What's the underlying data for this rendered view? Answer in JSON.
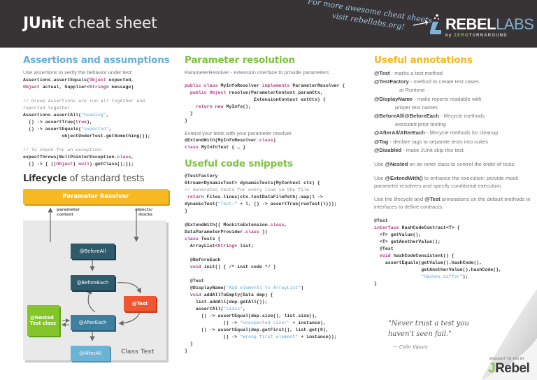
{
  "header": {
    "title_bold": "JUnit",
    "title_rest": " cheat sheet",
    "promo_line1": "For more awesome cheat sheets",
    "promo_line2": "visit rebellabs.org!",
    "logo_rebel": "REBEL",
    "logo_labs": "LABS",
    "logo_by": "by ",
    "logo_zero": "ZERO",
    "logo_turnaround": "TURNAROUND"
  },
  "assertions": {
    "heading": "Assertions and assumptions",
    "intro": "Use assertions to verify the behavior under test:",
    "signature_l1_a": "Assertions.assertEquals(",
    "signature_l1_kw": "Object",
    "signature_l1_b": " expected,",
    "signature_l2_kw": "Object",
    "signature_l2_a": " actual, Supplier<",
    "signature_l2_kw2": "String",
    "signature_l2_b": "> message)",
    "comment1_l1": "// Group assertions are run all together and",
    "comment1_l2": "reported together.",
    "group_l1_a": "Assertions.assertAll(",
    "group_l1_str": "\"heading\"",
    "group_l1_b": ",",
    "group_l2_a": "  () -> assertTrue(",
    "group_l2_kw": "true",
    "group_l2_b": "),",
    "group_l3_a": "  () -> assertEquals(",
    "group_l3_str": "\"expected\"",
    "group_l3_b": ",",
    "group_l4": "              objectUnderTest.getSomething());",
    "comment2": "// To check for an exception:",
    "throws_l1_a": "expectThrows(NullPointerException",
    "throws_l1_kw": ".class",
    "throws_l1_b": ",",
    "throws_l2_a": "  () -> { ((",
    "throws_l2_kw": "Object",
    "throws_l2_b": ") ",
    "throws_l2_kw2": "null",
    "throws_l2_c": ").getClass();});"
  },
  "lifecycle": {
    "heading_bold": "Lifecycle",
    "heading_rest": " of standard tests",
    "parameter_resolver": "Parameter Resolver",
    "label_parameter_context_1": "parameter",
    "label_parameter_context_2": "context",
    "label_objects_1": "objects/",
    "label_objects_2": "mocks",
    "before_all": "@BeforeAll",
    "before_each": "@BeforeEach",
    "test": "@Test",
    "after_each": "@AfterEach",
    "after_all": "@AfterAll",
    "nested_1": "@Nested",
    "nested_2": "Test class",
    "class_test": "Class Test",
    "colors": {
      "resolver": "#f6b921",
      "before": "#2e5a6b",
      "after_each": "#3f7f9f",
      "after_all": "#6db3d6",
      "test": "#ee5530",
      "nested": "#84c529"
    }
  },
  "param_resolution": {
    "heading": "Parameter resolution",
    "intro": "ParameterResolver - extension interface to provide parameters",
    "code_l1_kw": "public class",
    "code_l1_a": " MyInfoResolver ",
    "code_l1_kw2": "implements",
    "code_l1_b": " ParameterResolver {",
    "code_l2_kw": "  public Object",
    "code_l2_a": " resolve(ParameterContext paramCtx,",
    "code_l3": "                         ExtensionContext extCtx) {",
    "code_l4_kw": "    return new",
    "code_l4_a": " MyInfo();",
    "code_l5": "  }",
    "code_l6": "}",
    "extend_intro": "Extend your tests with your parameter resolver.",
    "extend_l1_a": "@ExtendWith(MyInfoResolver",
    "extend_l1_kw": ".class",
    "extend_l1_b": ")",
    "extend_l2_kw": "class",
    "extend_l2_a": " MyInfoTest { … }"
  },
  "snippets": {
    "heading": "Useful code snippets",
    "s1_l1": "@TestFactory",
    "s1_l2": "Stream<DynamicTest> dynamicTests(MyContext ctx) {",
    "s1_l3": "// Generates tests for every line in the file",
    "s1_l4_kw": " return",
    "s1_l4_a": " Files.lines(ctx.testDataFilePath).map(l ->",
    "s1_l5_a": "dynamicTest(",
    "s1_l5_str": "\"Test:\"",
    "s1_l5_b": " + l, () -> assertTrue(runTest(l)));",
    "s1_l6": "}",
    "s2_l1_a": "@ExtendWith({ MockitoExtension",
    "s2_l1_kw": ".class",
    "s2_l1_b": ",",
    "s2_l2_a": "DataParameterProvider",
    "s2_l2_kw": ".class",
    "s2_l2_b": " })",
    "s2_l3_kw": "class",
    "s2_l3_a": " Tests {",
    "s2_l4_a": "  ArrayList<",
    "s2_l4_kw": "String",
    "s2_l4_b": "> list;",
    "s2_l6": "  @BeforeEach",
    "s2_l7_kw": "  void",
    "s2_l7_a": " init() { /* init code */ }",
    "s2_l9": "  @Test",
    "s2_l10_a": "  @DisplayName(",
    "s2_l10_str": "\"Add elements to ArrayList\"",
    "s2_l10_b": ")",
    "s2_l11_kw": "  void",
    "s2_l11_a": " addAllToEmpty(Data dep) {",
    "s2_l12": "    list.addAll(dep.getAll());",
    "s2_l13_a": "    assertAll(",
    "s2_l13_str": "\"sizes\"",
    "s2_l13_b": ",",
    "s2_l14": "      () -> assertEqual(dep.size(), list.size(),",
    "s2_l15_a": "              () -> ",
    "s2_l15_str": "\"Unexpected size:\"",
    "s2_l15_b": " + instance),",
    "s2_l16": "      () -> assertEqual(dep.getFirst(), list.get(0),",
    "s2_l17_a": "              () -> ",
    "s2_l17_str": "\"Wrong first element\"",
    "s2_l17_b": " + instance));",
    "s2_l18": "  }",
    "s2_l19": "}"
  },
  "annotations": {
    "heading": "Useful annotations",
    "items": [
      {
        "name": "@Test",
        "desc": " - marks a test method",
        "cont": ""
      },
      {
        "name": "@TestFactory",
        "desc": " - method to create test cases",
        "cont": "at Runtime"
      },
      {
        "name": "@DisplayName",
        "desc": " - make reports readable with",
        "cont": "proper  test names"
      },
      {
        "name": "@BeforeAll/@BeforeEach",
        "desc": " - lifecycle methods",
        "cont": "executed prior testing"
      },
      {
        "name": "@AfterAll/AfterEach",
        "desc": " - lifecycle methods for cleanup",
        "cont": ""
      },
      {
        "name": "@Tag",
        "desc": " - declare tags to separate tests into suites",
        "cont": ""
      },
      {
        "name": "@Disabled",
        "desc": " - make JUnit skip this test.",
        "cont": ""
      }
    ],
    "nested_a": "Use ",
    "nested_b": "@Nested",
    "nested_c": " on an inner class to control the order of tests.",
    "extend_a": "Use ",
    "extend_b": "@ExtendWith()",
    "extend_c": " to enhance the execution: provide mock parameter resolvers and specify conditional execution.",
    "contract_a": "Use the lifecycle and ",
    "contract_b": "@Test",
    "contract_c": " annotations on the default methods in interfaces to define contracts:",
    "c_l1": "@Test",
    "c_l2_kw": "interface",
    "c_l2_a": " HashCodeContract<T> {",
    "c_l3": "  <T> getValue();",
    "c_l4": "  <T> getAnotherValue();",
    "c_l5": "  @Test",
    "c_l6_kw": "  void",
    "c_l6_a": " hashCodeConsistent() {",
    "c_l7": "    assertEquals(getValue().hashCode(),",
    "c_l8": "                 getAnotherValue().hashCode(),",
    "c_l9_pad": "                 ",
    "c_l9_str": "\"Hashes differ\"",
    "c_l9_b": ");",
    "c_l10": "}"
  },
  "footer": {
    "quote_l1": "\"Never trust a test you",
    "quote_l2": "haven't seen fail.\"",
    "author": "— Colin Vipurs",
    "brought": "BROUGHT TO YOU BY",
    "jrebel_j": "J",
    "jrebel_rest": "Rebel"
  }
}
